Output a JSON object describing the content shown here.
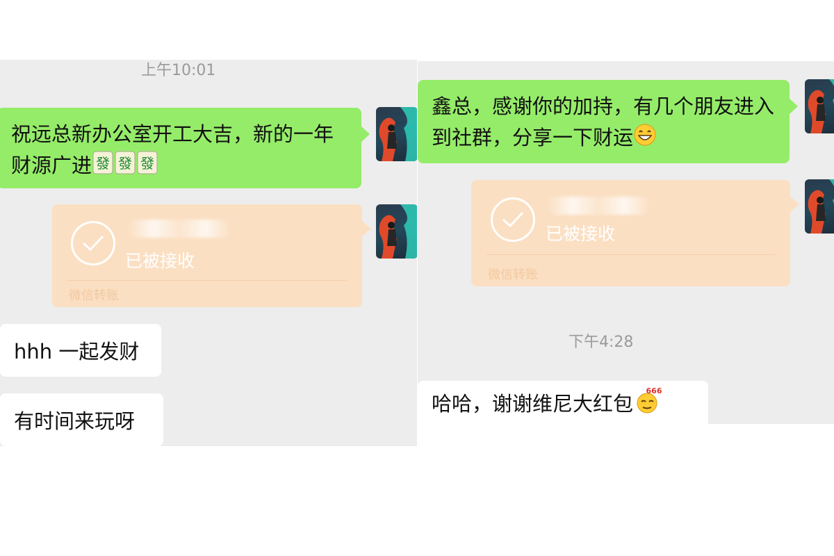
{
  "left": {
    "timestamp": "上午10:01",
    "sent_message": "祝远总新办公室开工大吉，新的一年财源广进",
    "sent_emojis": [
      "mahjong-fa-icon",
      "mahjong-fa-icon",
      "mahjong-fa-icon"
    ],
    "transfer": {
      "status": "已被接收",
      "footer": "微信转账"
    },
    "received": [
      {
        "text": "hhh 一起发财"
      },
      {
        "text": "有时间来玩呀"
      }
    ]
  },
  "right": {
    "sent_message": "鑫总，感谢你的加持，有几个朋友进入到社群，分享一下财运",
    "sent_emoji": "grin-emoji-icon",
    "transfer": {
      "status": "已被接收",
      "footer": "微信转账"
    },
    "timestamp": "下午4:28",
    "received": [
      {
        "text": "哈哈，谢谢维尼大红包",
        "emoji": "666-emoji-icon"
      }
    ]
  },
  "colors": {
    "green_bubble": "#95ec69",
    "transfer_bubble": "#fbdfc2",
    "chat_background": "#ededed"
  }
}
